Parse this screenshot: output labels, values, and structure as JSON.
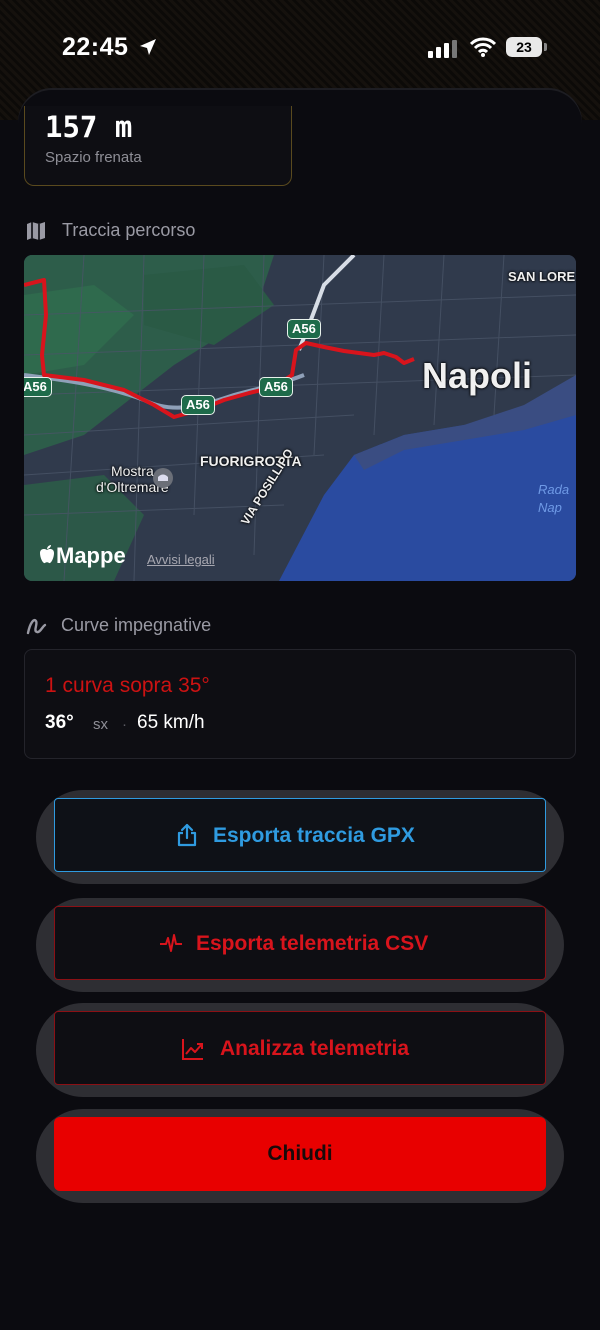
{
  "status_bar": {
    "time": "22:45",
    "battery": "23"
  },
  "brake": {
    "value": "157 m",
    "label": "Spazio frenata"
  },
  "route_section": {
    "title": "Traccia percorso",
    "icon": "map-icon"
  },
  "map": {
    "city_label": "Napoli",
    "district_label": "FUORIGROTTA",
    "poi_line1": "Mostra",
    "poi_line2": "d'Oltremare",
    "corner_label": "SAN LORE",
    "bay_line1": "Rada",
    "bay_line2": "Nap",
    "street_label": "VIA POSILLIPO",
    "highway_labels": [
      "A56",
      "A56",
      "A56",
      "A56"
    ],
    "attribution": "Mappe",
    "legal": "Avvisi legali",
    "route_color": "#d8141c"
  },
  "curves_section": {
    "title": "Curve impegnative",
    "icon": "curve-icon",
    "headline": "1 curva sopra 35°",
    "angle": "36°",
    "direction": "sx",
    "separator": "·",
    "speed": "65 km/h"
  },
  "buttons": {
    "gpx": "Esporta traccia GPX",
    "csv": "Esporta telemetria CSV",
    "analyze": "Analizza telemetria",
    "close": "Chiudi"
  },
  "colors": {
    "accent_blue": "#2f9be0",
    "accent_red": "#d8141c",
    "close_red": "#e80000",
    "brake_border": "#5a4a1e"
  }
}
